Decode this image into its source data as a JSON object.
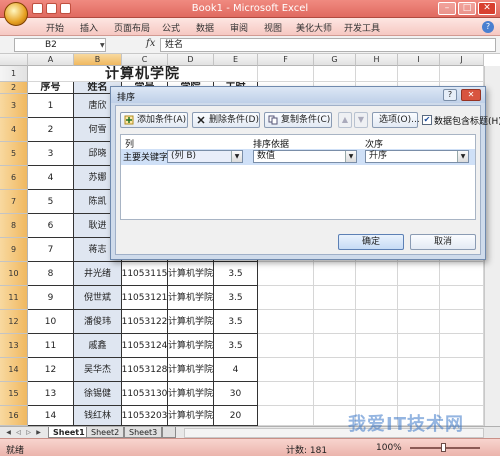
{
  "window": {
    "title": "Book1 - Microsoft Excel"
  },
  "ribbon": {
    "tabs": [
      "开始",
      "插入",
      "页面布局",
      "公式",
      "数据",
      "审阅",
      "视图",
      "美化大师",
      "开发工具"
    ]
  },
  "formula_bar": {
    "name_box": "B2",
    "fx": "fx",
    "content": "姓名"
  },
  "columns": [
    "A",
    "B",
    "C",
    "D",
    "E",
    "F",
    "G",
    "H",
    "I",
    "J"
  ],
  "rows": [
    "1",
    "2",
    "3",
    "4",
    "5",
    "6",
    "7",
    "8",
    "9",
    "10",
    "11",
    "12",
    "13",
    "14",
    "15",
    "16"
  ],
  "sheet": {
    "title": "计算机学院",
    "headers": [
      "序号",
      "姓名",
      "学号",
      "学院",
      "工时"
    ],
    "data": [
      [
        "1",
        "唐欣",
        "",
        "",
        ""
      ],
      [
        "2",
        "何雪",
        "",
        "",
        ""
      ],
      [
        "3",
        "邱晓",
        "",
        "",
        ""
      ],
      [
        "4",
        "苏娜",
        "",
        "",
        ""
      ],
      [
        "5",
        "陈凯",
        "",
        "",
        ""
      ],
      [
        "6",
        "耿进",
        "",
        "",
        ""
      ],
      [
        "7",
        "蒋志",
        "",
        "",
        ""
      ],
      [
        "8",
        "井光绪",
        "11053115",
        "计算机学院",
        "3.5"
      ],
      [
        "9",
        "倪世斌",
        "11053121",
        "计算机学院",
        "3.5"
      ],
      [
        "10",
        "潘俊玮",
        "11053122",
        "计算机学院",
        "3.5"
      ],
      [
        "11",
        "戚鑫",
        "11053124",
        "计算机学院",
        "3.5"
      ],
      [
        "12",
        "吴华杰",
        "11053128",
        "计算机学院",
        "4"
      ],
      [
        "13",
        "徐锡健",
        "11053130",
        "计算机学院",
        "30"
      ],
      [
        "14",
        "钱红林",
        "11053203",
        "计算机学院",
        "20"
      ]
    ]
  },
  "sort_dialog": {
    "title": "排序",
    "add_level": "添加条件(A)",
    "delete_level": "删除条件(D)",
    "copy_level": "复制条件(C)",
    "options": "选项(O)...",
    "has_headers": "数据包含标题(H)",
    "col_header": "列",
    "sort_on_header": "排序依据",
    "order_header": "次序",
    "row_label": "主要关键字",
    "column_value": "(列 B)",
    "sort_on_value": "数值",
    "order_value": "升序",
    "ok": "确定",
    "cancel": "取消"
  },
  "sheet_tabs": [
    "Sheet1",
    "Sheet2",
    "Sheet3"
  ],
  "status": {
    "ready": "就绪",
    "count": "计数: 181",
    "zoom": "100%"
  },
  "watermark": "我爱IT技术网"
}
